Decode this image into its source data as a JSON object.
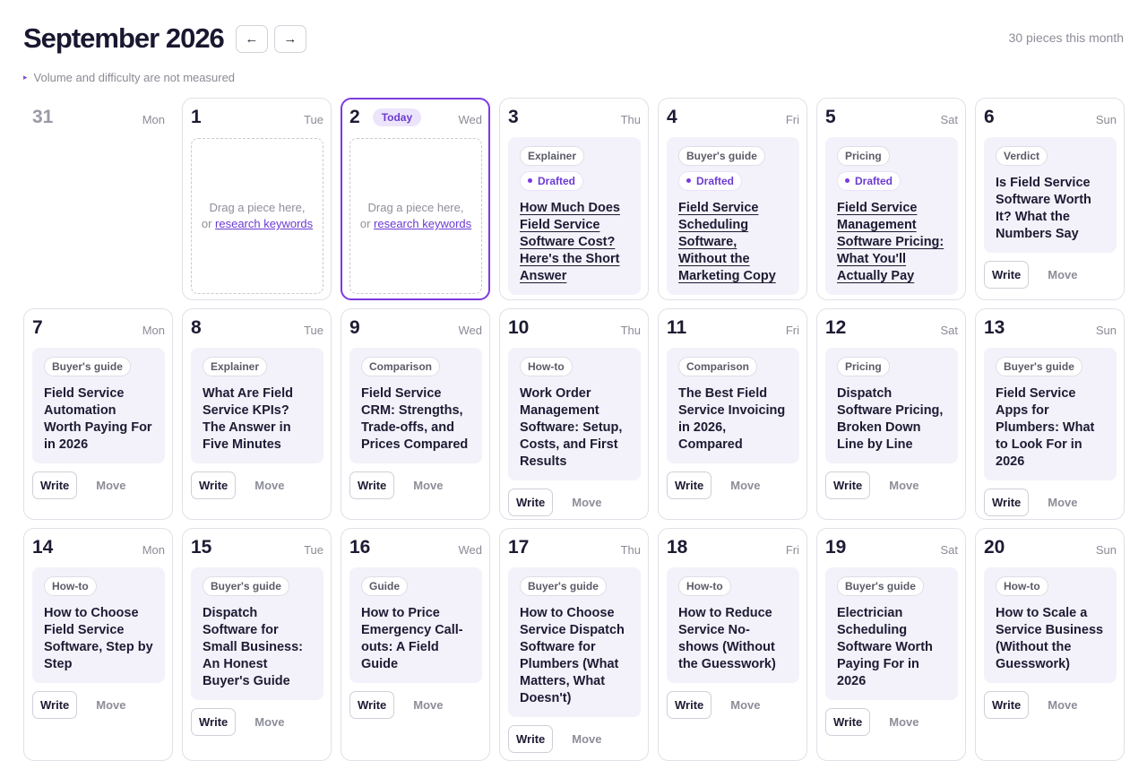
{
  "header": {
    "month_title": "September 2026",
    "prev_icon": "arrow-left-icon",
    "next_icon": "arrow-right-icon",
    "prev_glyph": "←",
    "next_glyph": "→",
    "pieces_count": "30 pieces this month"
  },
  "disclosure": {
    "icon": "triangle-right-icon",
    "glyph": "▸",
    "text": "Volume and difficulty are not measured"
  },
  "colors": {
    "accent": "#7c3ae0",
    "card_bg": "#f3f2fa",
    "muted_text": "#8b8b96"
  },
  "labels": {
    "today": "Today",
    "write": "Write",
    "move": "Move",
    "drop_prefix": "Drag a piece here,",
    "drop_or": "or",
    "drop_link": "research keywords"
  },
  "days": [
    {
      "num": "31",
      "weekday": "Mon",
      "kind": "blank"
    },
    {
      "num": "1",
      "weekday": "Tue",
      "kind": "empty"
    },
    {
      "num": "2",
      "weekday": "Wed",
      "kind": "empty",
      "today": true
    },
    {
      "num": "3",
      "weekday": "Thu",
      "kind": "piece",
      "tag": "Explainer",
      "status": "Drafted",
      "title": "How Much Does Field Service Software Cost? Here's the Short Answer"
    },
    {
      "num": "4",
      "weekday": "Fri",
      "kind": "piece",
      "tag": "Buyer's guide",
      "status": "Drafted",
      "title": "Field Service Scheduling Software, Without the Marketing Copy"
    },
    {
      "num": "5",
      "weekday": "Sat",
      "kind": "piece",
      "tag": "Pricing",
      "status": "Drafted",
      "title": "Field Service Management Software Pricing: What You'll Actually Pay"
    },
    {
      "num": "6",
      "weekday": "Sun",
      "kind": "piece",
      "tag": "Verdict",
      "title": "Is Field Service Software Worth It? What the Numbers Say"
    },
    {
      "num": "7",
      "weekday": "Mon",
      "kind": "piece",
      "tag": "Buyer's guide",
      "title": "Field Service Automation Worth Paying For in 2026"
    },
    {
      "num": "8",
      "weekday": "Tue",
      "kind": "piece",
      "tag": "Explainer",
      "title": "What Are Field Service KPIs? The Answer in Five Minutes"
    },
    {
      "num": "9",
      "weekday": "Wed",
      "kind": "piece",
      "tag": "Comparison",
      "title": "Field Service CRM: Strengths, Trade-offs, and Prices Compared"
    },
    {
      "num": "10",
      "weekday": "Thu",
      "kind": "piece",
      "tag": "How-to",
      "title": "Work Order Management Software: Setup, Costs, and First Results"
    },
    {
      "num": "11",
      "weekday": "Fri",
      "kind": "piece",
      "tag": "Comparison",
      "title": "The Best Field Service Invoicing in 2026, Compared"
    },
    {
      "num": "12",
      "weekday": "Sat",
      "kind": "piece",
      "tag": "Pricing",
      "title": "Dispatch Software Pricing, Broken Down Line by Line"
    },
    {
      "num": "13",
      "weekday": "Sun",
      "kind": "piece",
      "tag": "Buyer's guide",
      "title": "Field Service Apps for Plumbers: What to Look For in 2026"
    },
    {
      "num": "14",
      "weekday": "Mon",
      "kind": "piece",
      "tag": "How-to",
      "title": "How to Choose Field Service Software, Step by Step"
    },
    {
      "num": "15",
      "weekday": "Tue",
      "kind": "piece",
      "tag": "Buyer's guide",
      "title": "Dispatch Software for Small Business: An Honest Buyer's Guide"
    },
    {
      "num": "16",
      "weekday": "Wed",
      "kind": "piece",
      "tag": "Guide",
      "title": "How to Price Emergency Call-outs: A Field Guide"
    },
    {
      "num": "17",
      "weekday": "Thu",
      "kind": "piece",
      "tag": "Buyer's guide",
      "title": "How to Choose Service Dispatch Software for Plumbers (What Matters, What Doesn't)"
    },
    {
      "num": "18",
      "weekday": "Fri",
      "kind": "piece",
      "tag": "How-to",
      "title": "How to Reduce Service No-shows (Without the Guesswork)"
    },
    {
      "num": "19",
      "weekday": "Sat",
      "kind": "piece",
      "tag": "Buyer's guide",
      "title": "Electrician Scheduling Software Worth Paying For in 2026"
    },
    {
      "num": "20",
      "weekday": "Sun",
      "kind": "piece",
      "tag": "How-to",
      "title": "How to Scale a Service Business (Without the Guesswork)"
    }
  ]
}
